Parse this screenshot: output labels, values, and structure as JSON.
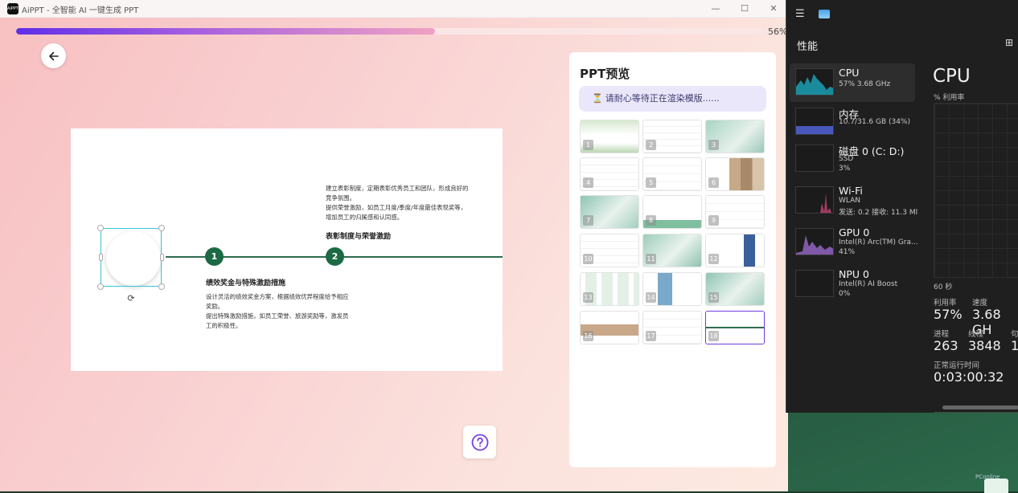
{
  "window": {
    "title": "AiPPT - 全智能 AI 一键生成 PPT",
    "logo_text": "AiPPT",
    "minimize_glyph": "—",
    "maximize_glyph": "☐",
    "close_glyph": "✕"
  },
  "progress": {
    "value": 0.56,
    "label": "56%"
  },
  "slide": {
    "nodes": [
      "1",
      "2"
    ],
    "heading_1": "绩效奖金与特殊激励措施",
    "body_1_line1": "设计灵活的绩效奖金方案，根据绩效优异程度给予相应",
    "body_1_line2": "奖励。",
    "body_1_line3": "提出特殊激励措施，如员工荣誉、旅游奖励等，激发员",
    "body_1_line4": "工的积极性。",
    "heading_2": "表彰制度与荣誉激励",
    "body_2_line1": "建立表彰制度，定期表彰优秀员工和团队，形成良好的",
    "body_2_line2": "竞争氛围。",
    "body_2_line3": "提供荣誉激励，如员工月度/季度/年度最佳表现奖等，",
    "body_2_line4": "增加员工的归属感和认同感。"
  },
  "preview": {
    "title": "PPT预览",
    "status": "请耐心等待正在渲染模版......",
    "thumbnails": [
      "1",
      "2",
      "3",
      "4",
      "5",
      "6",
      "7",
      "8",
      "9",
      "10",
      "11",
      "12",
      "13",
      "14",
      "15",
      "16",
      "17",
      "18"
    ],
    "active_thumbnail": "18"
  },
  "taskmanager": {
    "section": "性能",
    "items": [
      {
        "name": "CPU",
        "sub1": "57%  3.68 GHz",
        "sub2": "",
        "color": "#17a2b8"
      },
      {
        "name": "内存",
        "sub1": "10.7/31.6 GB (34%)",
        "sub2": "",
        "color": "#5b6cd8"
      },
      {
        "name": "磁盘 0 (C: D:)",
        "sub1": "SSD",
        "sub2": "3%",
        "color": "#3aa157"
      },
      {
        "name": "Wi-Fi",
        "sub1": "WLAN",
        "sub2": "发送: 0.2  接收: 11.3 Ml",
        "color": "#c2457a"
      },
      {
        "name": "GPU 0",
        "sub1": "Intel(R) Arc(TM) Gra...",
        "sub2": "41%",
        "color": "#9a66c8"
      },
      {
        "name": "NPU 0",
        "sub1": "Intel(R) AI Boost",
        "sub2": "0%",
        "color": "#1d87c9"
      }
    ],
    "main_title": "CPU",
    "main_sub": "% 利用率",
    "chart_span": "60 秒",
    "stats": {
      "util_label": "利用率",
      "util_value": "57%",
      "speed_label": "速度",
      "speed_value": "3.68 GH",
      "proc_label": "进程",
      "proc_value": "263",
      "thread_label": "线程",
      "thread_value": "3848",
      "handle_label": "句",
      "handle_value": "1",
      "uptime_label": "正常运行时间",
      "uptime_value": "0:03:00:32"
    }
  },
  "watermark": "PConline"
}
